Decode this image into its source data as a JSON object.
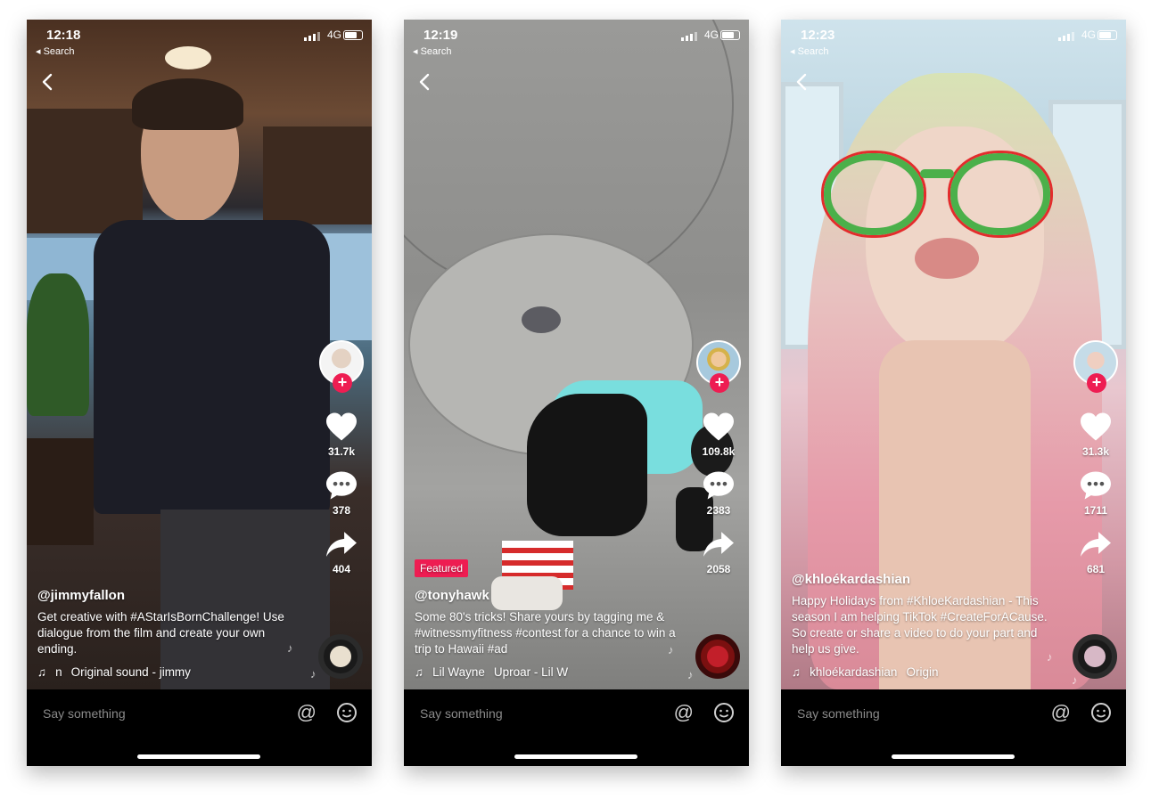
{
  "colors": {
    "accent": "#ee1d52",
    "comment_bar": "#000000",
    "placeholder_text": "#8a8a8a"
  },
  "phones": [
    {
      "status": {
        "time": "12:18",
        "back_label": "◂ Search",
        "network": "4G"
      },
      "featured": "",
      "handle": "@jimmyfallon",
      "description": "Get creative with #AStarIsBornChallenge! Use dialogue from the film and create your own ending.",
      "sound_user": "n",
      "sound_title": "Original sound - jimmy",
      "likes": "31.7k",
      "comments": "378",
      "shares": "404",
      "comment_placeholder": "Say something"
    },
    {
      "status": {
        "time": "12:19",
        "back_label": "◂ Search",
        "network": "4G"
      },
      "featured": "Featured",
      "handle": "@tonyhawk",
      "description": "Some 80's tricks! Share yours by tagging me & #witnessmyfitness #contest for a chance to win a trip to Hawaii #ad",
      "sound_user": "Lil Wayne",
      "sound_title": "Uproar - Lil W",
      "likes": "109.8k",
      "comments": "2383",
      "shares": "2058",
      "comment_placeholder": "Say something"
    },
    {
      "status": {
        "time": "12:23",
        "back_label": "◂ Search",
        "network": "4G"
      },
      "featured": "",
      "handle": "@khloékardashian",
      "description": "Happy Holidays from #KhloeKardashian - This season I am helping TikTok #CreateForACause. So create or share a video to do your part and help us give.",
      "sound_user": "khloékardashian",
      "sound_title": "Origin",
      "likes": "31.3k",
      "comments": "1711",
      "shares": "681",
      "comment_placeholder": "Say something"
    }
  ]
}
